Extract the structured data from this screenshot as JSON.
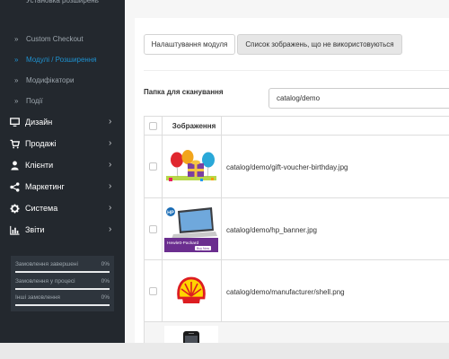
{
  "sidebar": {
    "submenu": [
      {
        "label": "Установка розширень",
        "active": false
      },
      {
        "label": "Custom Checkout",
        "active": false
      },
      {
        "label": "Модулі / Розширення",
        "active": true
      },
      {
        "label": "Модифікатори",
        "active": false
      },
      {
        "label": "Події",
        "active": false
      }
    ],
    "menu": [
      {
        "label": "Дизайн",
        "icon": "monitor-icon"
      },
      {
        "label": "Продажі",
        "icon": "cart-icon"
      },
      {
        "label": "Клієнти",
        "icon": "user-icon"
      },
      {
        "label": "Маркетинг",
        "icon": "share-icon"
      },
      {
        "label": "Система",
        "icon": "cog-icon"
      },
      {
        "label": "Звіти",
        "icon": "bar-chart-icon"
      }
    ],
    "arrow": "›",
    "chevron": "»",
    "stats": [
      {
        "label": "Замовлення завершені",
        "value": "0%",
        "progress": 0
      },
      {
        "label": "Замовлення у процесі",
        "value": "0%",
        "progress": 0
      },
      {
        "label": "Інші замовлення",
        "value": "0%",
        "progress": 0
      }
    ]
  },
  "main": {
    "tabs": [
      {
        "label": "Налаштування модуля",
        "active": false
      },
      {
        "label": "Список зображень, що не використовуються",
        "active": true
      }
    ],
    "scan": {
      "label": "Папка для сканування",
      "value": "catalog/demo"
    },
    "table": {
      "header_image": "Зображення",
      "rows": [
        {
          "path": "catalog/demo/gift-voucher-birthday.jpg",
          "thumb": "gift-voucher-thumbnail"
        },
        {
          "path": "catalog/demo/hp_banner.jpg",
          "thumb": "hp-banner-thumbnail",
          "banner_brand": "Hewlett-Packard",
          "banner_button": "Buy Now",
          "banner_logo": "HP"
        },
        {
          "path": "catalog/demo/manufacturer/shell.png",
          "thumb": "shell-logo-thumbnail"
        },
        {
          "path": "",
          "thumb": "iphone-thumbnail"
        }
      ]
    }
  },
  "colors": {
    "sidebar_bg": "#23282e",
    "active": "#1e91cf",
    "panel": "#2e353d"
  }
}
